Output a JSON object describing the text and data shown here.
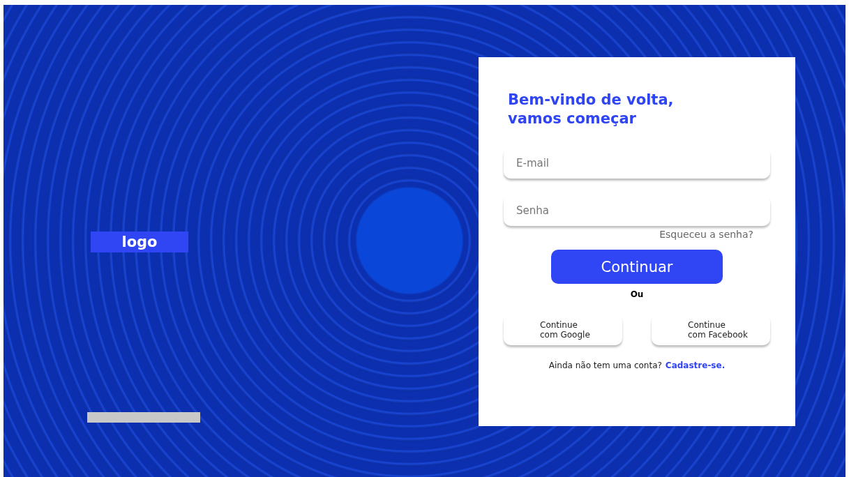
{
  "logo": {
    "label": "logo"
  },
  "login": {
    "title": "Bem-vindo de volta,\nvamos começar",
    "fields": [
      {
        "placeholder": "E-mail"
      },
      {
        "placeholder": "Senha"
      }
    ],
    "forgot_link": "Esqueceu a senha?",
    "submit": "Continuar",
    "divider": "Ou",
    "social_buttons": [
      "Continue\ncom Google",
      "Continue\ncom Facebook"
    ],
    "signup_prompt": "Ainda não tem uma conta?",
    "signup_link": "Cadastre-se."
  }
}
